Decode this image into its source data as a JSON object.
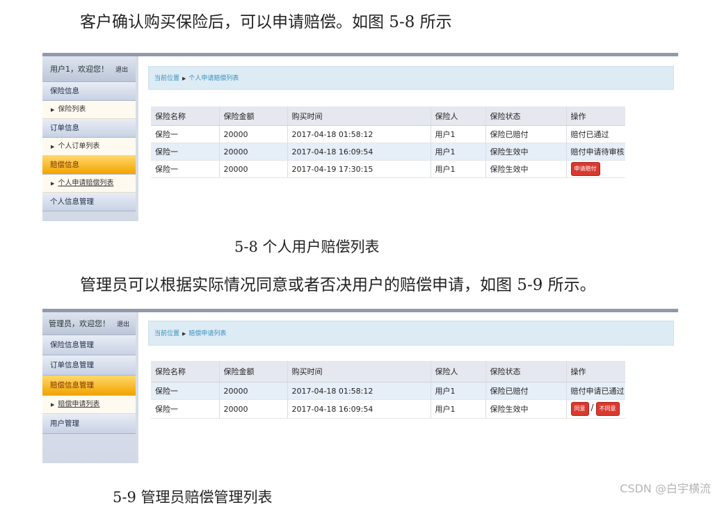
{
  "paragraph1": "客户确认购买保险后，可以申请赔偿。如图 5-8 所示",
  "caption1": "5-8 个人用户赔偿列表",
  "paragraph2": "管理员可以根据实际情况同意或者否决用户的赔偿申请，如图 5-9 所示。",
  "caption2": "5-9 管理员赔偿管理列表",
  "watermark": "CSDN @白宇横流",
  "shot1": {
    "greeting": "用户1，欢迎您！",
    "logout": "退出",
    "menu": {
      "item1": "保险信息",
      "sub1": "保险列表",
      "item2": "订单信息",
      "sub2": "个人订单列表",
      "item3": "赔偿信息",
      "sub3": "个人申请赔偿列表",
      "item4": "个人信息管理"
    },
    "breadcrumb": {
      "label": "当前位置",
      "page": "个人申请赔偿列表"
    },
    "headers": [
      "保险名称",
      "保险金额",
      "购买时间",
      "保险人",
      "保险状态",
      "操作"
    ],
    "rows": [
      {
        "name": "保险一",
        "amount": "20000",
        "time": "2017-04-18 01:58:12",
        "holder": "用户1",
        "status": "保险已赔付",
        "action": "赔付已通过"
      },
      {
        "name": "保险一",
        "amount": "20000",
        "time": "2017-04-18 16:09:54",
        "holder": "用户1",
        "status": "保险生效中",
        "action": "赔付申请待审核"
      },
      {
        "name": "保险一",
        "amount": "20000",
        "time": "2017-04-19 17:30:15",
        "holder": "用户1",
        "status": "保险生效中",
        "action": "申请赔付"
      }
    ]
  },
  "shot2": {
    "greeting": "管理员，欢迎您！",
    "logout": "退出",
    "menu": {
      "item1": "保险信息管理",
      "item2": "订单信息管理",
      "item3": "赔偿信息管理",
      "sub3": "赔偿申请列表",
      "item4": "用户管理"
    },
    "breadcrumb": {
      "label": "当前位置",
      "page": "赔偿申请列表"
    },
    "headers": [
      "保险名称",
      "保险金额",
      "购买时间",
      "保险人",
      "保险状态",
      "操作"
    ],
    "rows": [
      {
        "name": "保险一",
        "amount": "20000",
        "time": "2017-04-18 01:58:12",
        "holder": "用户1",
        "status": "保险已赔付",
        "action": "赔付申请已通过"
      },
      {
        "name": "保险一",
        "amount": "20000",
        "time": "2017-04-18 16:09:54",
        "holder": "用户1",
        "status": "保险生效中",
        "approve": "同意",
        "reject": "不同意"
      }
    ]
  }
}
